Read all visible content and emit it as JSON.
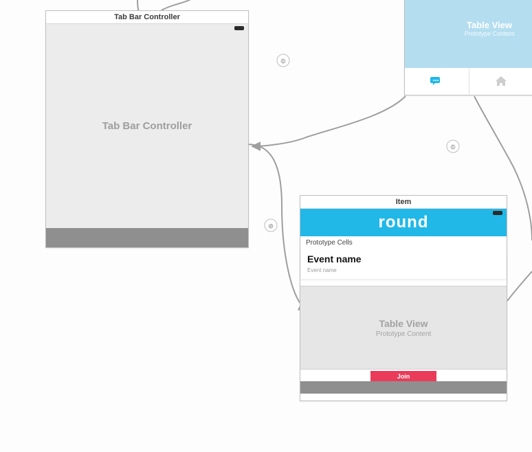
{
  "tab_controller": {
    "scene_title": "Tab Bar Controller",
    "body_label": "Tab Bar Controller"
  },
  "item_scene": {
    "scene_title": "Item",
    "navbar_title": "round",
    "prototype_label": "Prototype Cells",
    "cell_title": "Event name",
    "cell_subtitle": "Event name",
    "tableview_title": "Table View",
    "tableview_sub": "Prototype Content",
    "cta_label": "Join"
  },
  "peek_scene": {
    "tableview_title": "Table View",
    "tableview_sub": "Prototype Content"
  },
  "colors": {
    "accent": "#21b8e8",
    "cta": "#ea3b5a",
    "light_accent": "#b4def0"
  }
}
